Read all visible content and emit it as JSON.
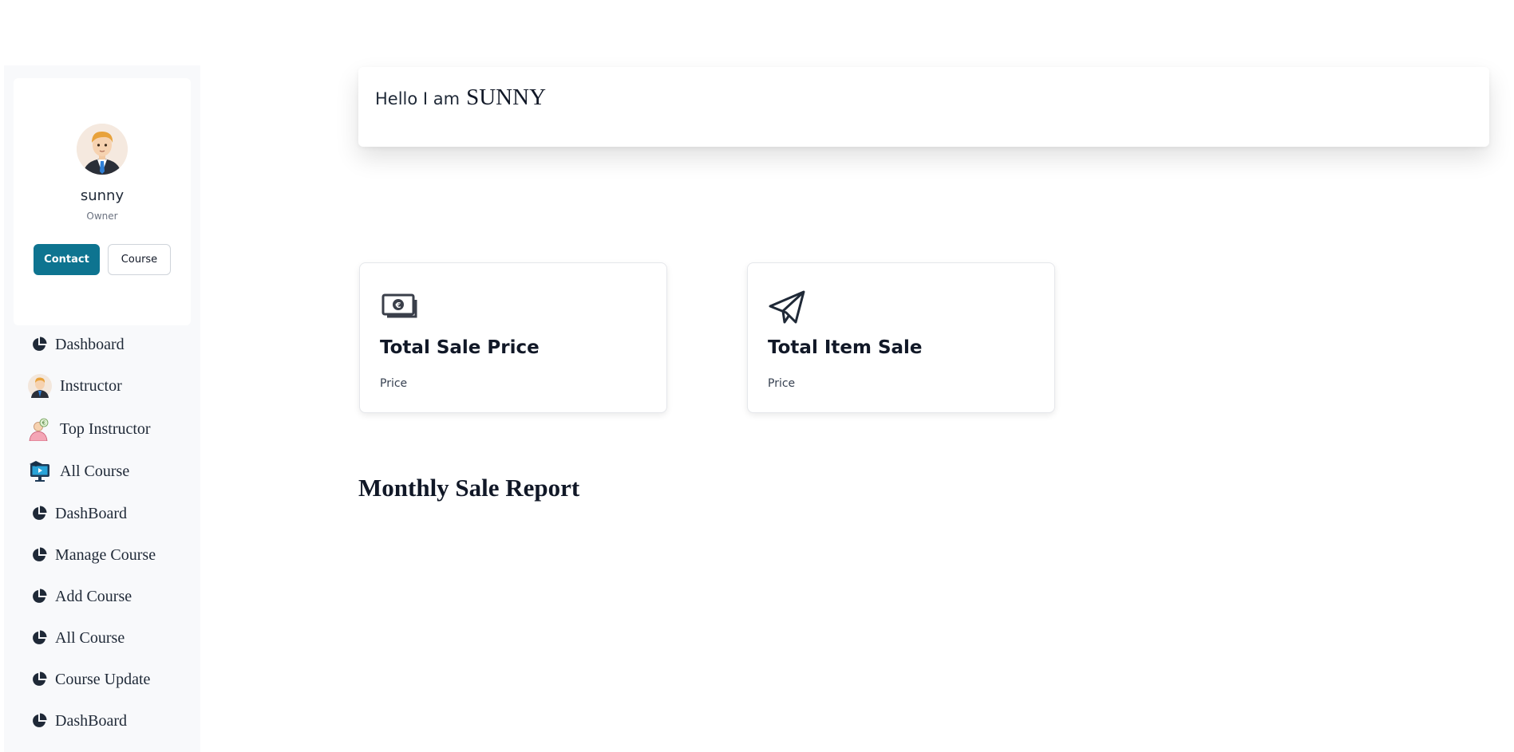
{
  "profile": {
    "name": "sunny",
    "role": "Owner",
    "avatar_icon": "businessman-avatar",
    "contact_label": "Contact",
    "course_label": "Course",
    "accent_color": "#0e7490"
  },
  "sidebar": {
    "items": [
      {
        "label": "Dashboard",
        "icon": "pie-chart-icon"
      },
      {
        "label": "Instructor",
        "icon": "instructor-avatar-icon"
      },
      {
        "label": "Top Instructor",
        "icon": "top-instructor-icon"
      },
      {
        "label": "All Course",
        "icon": "video-course-icon"
      },
      {
        "label": "DashBoard",
        "icon": "pie-chart-icon"
      },
      {
        "label": "Manage Course",
        "icon": "pie-chart-icon"
      },
      {
        "label": "Add Course",
        "icon": "pie-chart-icon"
      },
      {
        "label": "All Course",
        "icon": "pie-chart-icon"
      },
      {
        "label": "Course Update",
        "icon": "pie-chart-icon"
      },
      {
        "label": "DashBoard",
        "icon": "pie-chart-icon"
      }
    ]
  },
  "header": {
    "greeting": "Hello I am",
    "name": "SUNNY"
  },
  "stats": [
    {
      "title": "Total Sale Price",
      "subtitle": "Price",
      "icon": "money-icon"
    },
    {
      "title": "Total Item Sale",
      "subtitle": "Price",
      "icon": "paper-plane-icon"
    }
  ],
  "report": {
    "title": "Monthly Sale Report"
  }
}
